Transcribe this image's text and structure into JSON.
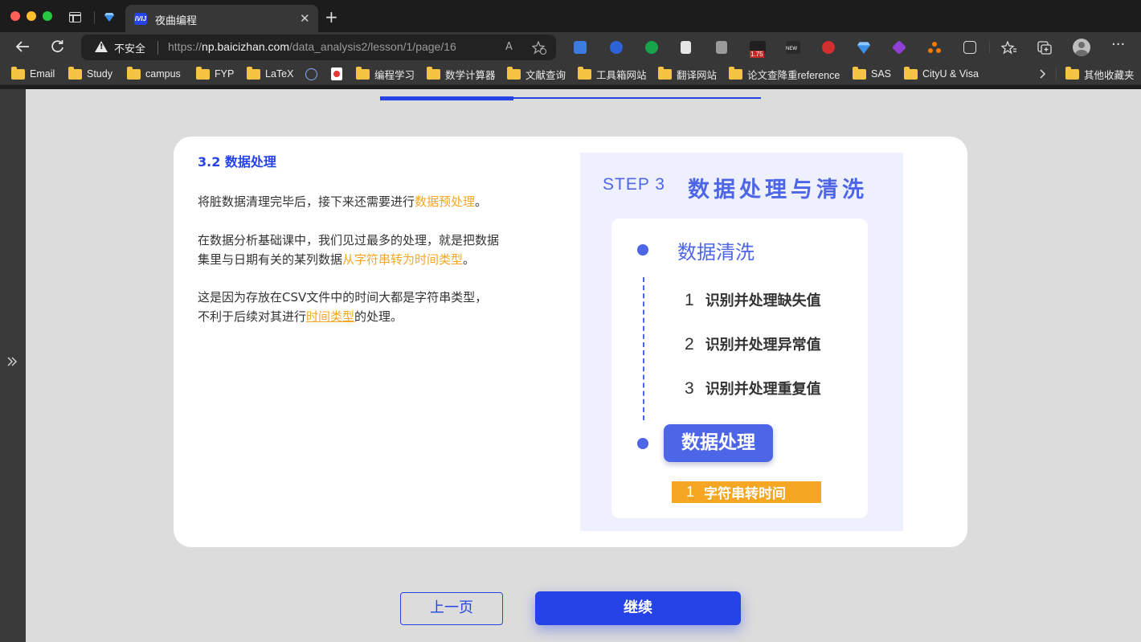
{
  "browser": {
    "tab": {
      "favicon_text": "IVIJ",
      "title": "夜曲编程",
      "close": "✕"
    },
    "new_tab": "+",
    "security_label": "不安全",
    "url": {
      "prefix": "https://",
      "domain": "np.baicizhan.com",
      "path": "/data_analysis2/lesson/1/page/16"
    },
    "ext_badge": "1.75",
    "ext_new": "NEW",
    "more": "···"
  },
  "bookmarks": [
    "Email",
    "Study",
    "campus",
    "FYP",
    "LaTeX",
    "编程学习",
    "数学计算器",
    "文献查询",
    "工具箱网站",
    "翻译网站",
    "论文查降重reference",
    "SAS",
    "CityU & Visa"
  ],
  "bookmarks_other": "其他收藏夹",
  "lesson": {
    "section_title": "3.2 数据处理",
    "p1_before": "将脏数据清理完毕后，接下来还需要进行",
    "p1_highlight": "数据预处理",
    "p1_after": "。",
    "p2_before": "在数据分析基础课中，我们见过最多的处理，就是把数据集里与日期有关的某列数据",
    "p2_highlight": "从字符串转为时间类型",
    "p2_after": "。",
    "p3_before": "这是因为存放在CSV文件中的时间大都是字符串类型，不利于后续对其进行",
    "p3_link": "时间类型",
    "p3_after": "的处理。",
    "progress_fraction": 0.35
  },
  "slide": {
    "step_label": "STEP 3",
    "step_title": "数据处理与清洗",
    "clean_heading": "数据清洗",
    "clean_items": [
      {
        "num": "1",
        "text": "识别并处理缺失值"
      },
      {
        "num": "2",
        "text": "识别并处理异常值"
      },
      {
        "num": "3",
        "text": "识别并处理重复值"
      }
    ],
    "process_heading": "数据处理",
    "process_item": {
      "num": "1",
      "text": "字符串转时间"
    }
  },
  "buttons": {
    "prev": "上一页",
    "next": "继续"
  },
  "colors": {
    "accent": "#2643e8",
    "slide_blue": "#4d66e8",
    "highlight": "#f5a623"
  }
}
